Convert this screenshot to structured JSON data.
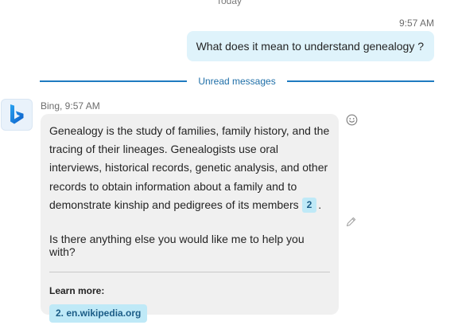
{
  "date_separator": "Today",
  "user_message": {
    "time": "9:57 AM",
    "text": "What does it mean to understand genealogy ?"
  },
  "unread_divider": "Unread messages",
  "bot_message": {
    "avatar_icon": "bing-logo-icon",
    "sender_line": "Bing, 9:57 AM",
    "body": "Genealogy is the study of families, family history, and the tracing of their lineages. Genealogists use oral interviews, historical records, genetic analysis, and other records to obtain information about a family and to demonstrate kinship and pedigrees of its members",
    "citation": "2",
    "body_end": ".",
    "followup": "Is there anything else you would like me to help you with?",
    "learn_more_title": "Learn more:",
    "links": [
      {
        "label": "2. en.wikipedia.org"
      }
    ]
  },
  "icons": {
    "react": "smiley-react-icon",
    "edit": "pencil-edit-icon"
  },
  "colors": {
    "sent_bubble": "#dff3fb",
    "bot_bubble": "#f0f0f0",
    "accent": "#1f7bc0",
    "citation_bg": "#bfe9f7"
  }
}
